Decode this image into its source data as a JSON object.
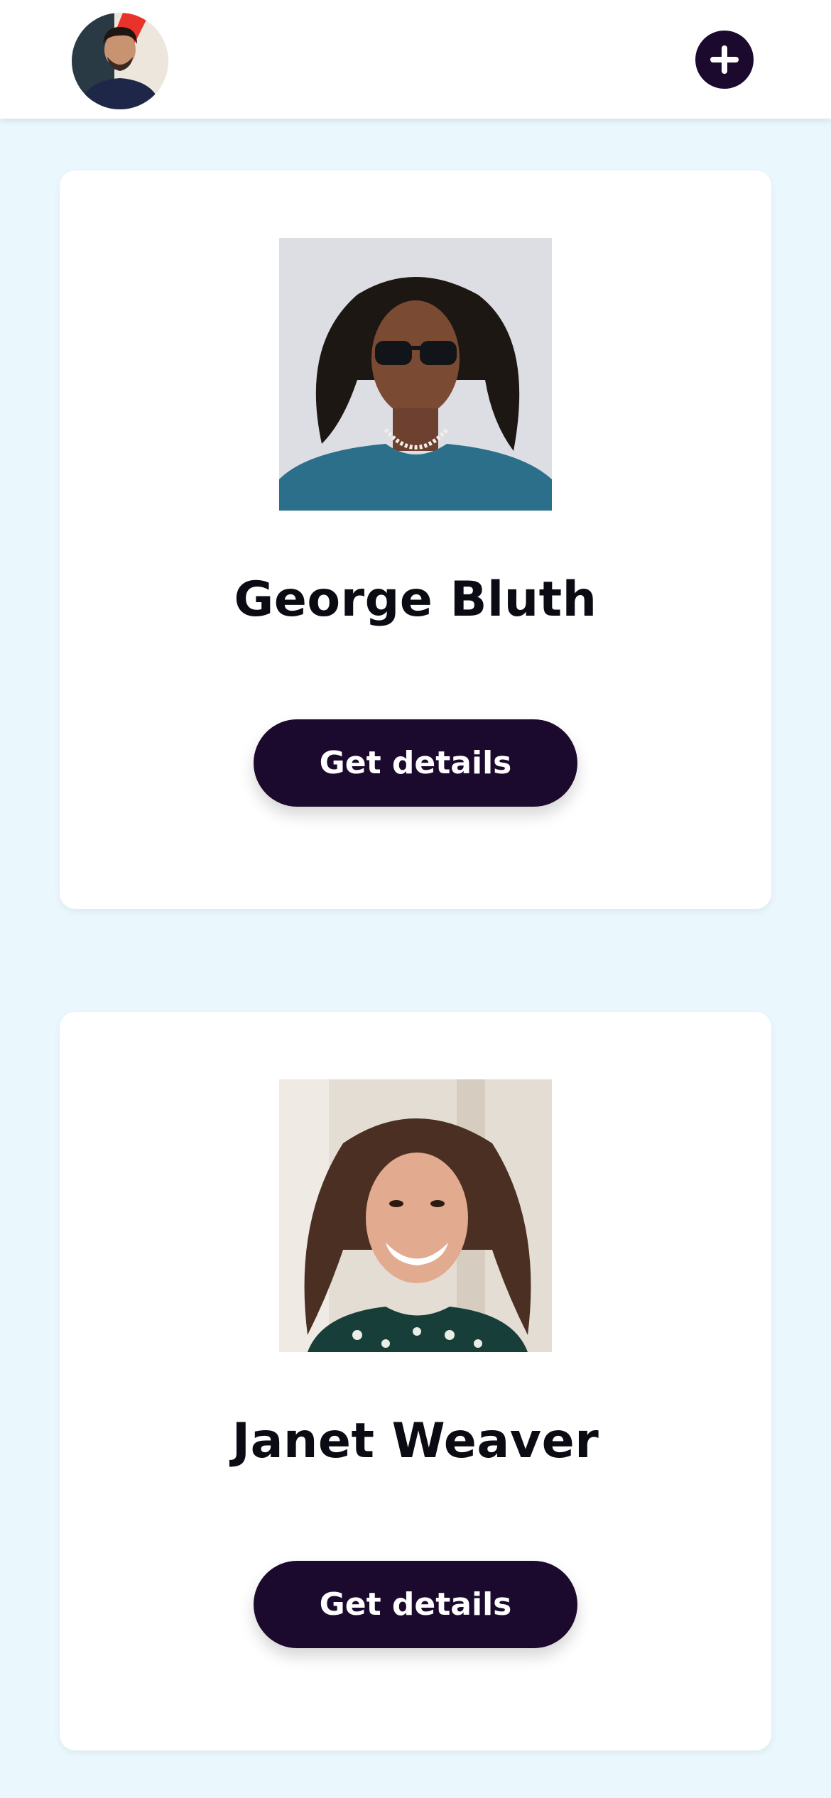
{
  "header": {
    "avatar_icon": "user-avatar-photo",
    "add_icon": "plus-icon"
  },
  "users": [
    {
      "name": "George Bluth",
      "photo_icon": "user-photo",
      "button_label": "Get details"
    },
    {
      "name": "Janet Weaver",
      "photo_icon": "user-photo",
      "button_label": "Get details"
    }
  ],
  "colors": {
    "background": "#eaf8fd",
    "accent": "#1b0a2e",
    "card": "#ffffff"
  }
}
